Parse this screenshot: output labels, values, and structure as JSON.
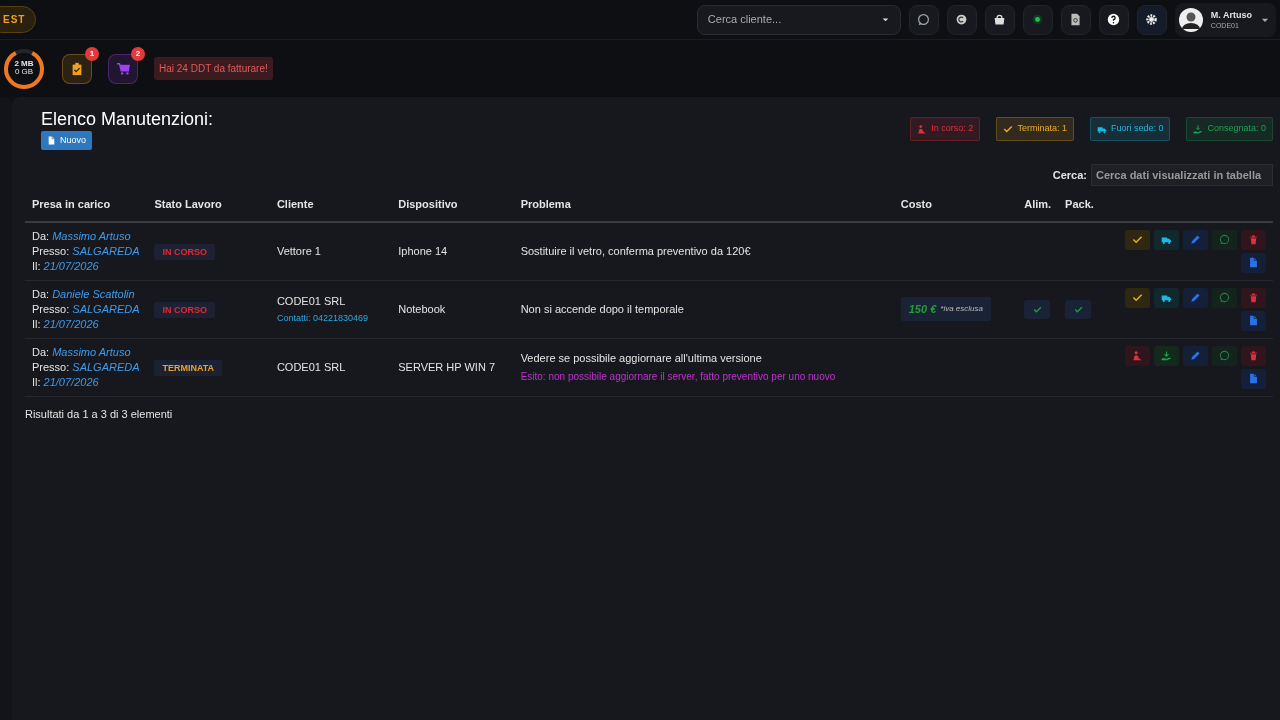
{
  "topbar": {
    "badge": "EST",
    "customer_search": {
      "placeholder": "Cerca cliente..."
    },
    "icons": [
      {
        "kind": "chat"
      },
      {
        "kind": "coin"
      },
      {
        "kind": "bag"
      },
      {
        "kind": "dot"
      },
      {
        "kind": "doc-search"
      },
      {
        "kind": "help"
      },
      {
        "kind": "gear"
      }
    ],
    "user": {
      "name": "M. Artuso",
      "code": "CODE01"
    }
  },
  "quickbar": {
    "storage": {
      "used": "2 MB",
      "total": "0 GB",
      "level": 0.85
    },
    "shortcuts": [
      {
        "kind": "clipboard",
        "count": "1",
        "color": "#f0a020"
      },
      {
        "kind": "cart",
        "count": "2",
        "color": "#a040f0"
      }
    ],
    "alert": "Hai 24 DDT da fatturare!"
  },
  "page": {
    "title": "Elenco Manutenzioni:",
    "new_button": "Nuovo",
    "counters": [
      {
        "kind": "in-progress",
        "label": "In corso: 2",
        "color": "#e0303a"
      },
      {
        "kind": "done",
        "label": "Terminata: 1",
        "color": "#e8b020"
      },
      {
        "kind": "offsite",
        "label": "Fuori sede: 0",
        "color": "#20b8e0"
      },
      {
        "kind": "delivered",
        "label": "Consegnata: 0",
        "color": "#20a050"
      }
    ],
    "search": {
      "label": "Cerca:",
      "placeholder": "Cerca dati visualizzati in tabella"
    }
  },
  "table": {
    "columns": [
      "Presa in carico",
      "Stato Lavoro",
      "Cliente",
      "Dispositivo",
      "Problema",
      "Costo",
      "Alim.",
      "Pack."
    ],
    "rows": [
      {
        "taken": [
          {
            "label": "Da:",
            "value": "Massimo Artuso"
          },
          {
            "label": "Presso:",
            "value": "SALGAREDA"
          },
          {
            "label": "Il:",
            "value": "21/07/2026"
          }
        ],
        "status": {
          "kind": "in-progress",
          "label": "IN CORSO"
        },
        "client": "Vettore 1",
        "device": "Iphone 14",
        "problem": "Sostituire il vetro, conferma preventivo da 120€",
        "alim": false,
        "pack": false,
        "actions": [
          {
            "kind": "complete"
          },
          {
            "kind": "offsite"
          },
          {
            "kind": "edit"
          },
          {
            "kind": "chat"
          },
          {
            "kind": "delete"
          },
          {
            "kind": "document"
          }
        ]
      },
      {
        "taken": [
          {
            "label": "Da:",
            "value": "Daniele Scattolin"
          },
          {
            "label": "Presso:",
            "value": "SALGAREDA"
          },
          {
            "label": "Il:",
            "value": "21/07/2026"
          }
        ],
        "status": {
          "kind": "in-progress",
          "label": "IN CORSO"
        },
        "client": "CODE01 SRL",
        "contact": "Contatti: 04221830469",
        "device": "Notebook",
        "problem": "Non si accende dopo il temporale",
        "cost": {
          "amount": "150 €",
          "note": "*iva esclusa"
        },
        "alim": true,
        "pack": true,
        "actions": [
          {
            "kind": "complete"
          },
          {
            "kind": "offsite"
          },
          {
            "kind": "edit"
          },
          {
            "kind": "chat"
          },
          {
            "kind": "delete"
          },
          {
            "kind": "document"
          }
        ]
      },
      {
        "taken": [
          {
            "label": "Da:",
            "value": "Massimo Artuso"
          },
          {
            "label": "Presso:",
            "value": "SALGAREDA"
          },
          {
            "label": "Il:",
            "value": "21/07/2026"
          }
        ],
        "status": {
          "kind": "done",
          "label": "TERMINATA"
        },
        "client": "CODE01 SRL",
        "device": "SERVER HP WIN 7",
        "problem": "Vedere se possibile aggiornare all'ultima versione",
        "outcome": "Esito: non possibile aggiornare il server, fatto preventivo per uno nuovo",
        "alim": false,
        "pack": false,
        "actions": [
          {
            "kind": "reopen"
          },
          {
            "kind": "deliver"
          },
          {
            "kind": "edit"
          },
          {
            "kind": "chat"
          },
          {
            "kind": "delete"
          },
          {
            "kind": "document"
          }
        ]
      }
    ]
  },
  "footer": "Risultati da 1 a 3 di 3 elementi"
}
